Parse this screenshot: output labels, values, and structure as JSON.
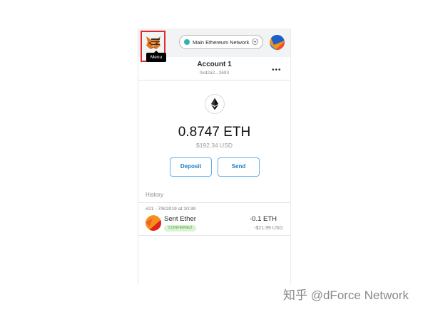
{
  "header": {
    "network_label": "Main Ethereum Network"
  },
  "account": {
    "name": "Account 1",
    "address": "0xd2a2...2693",
    "menu_tooltip": "Menu",
    "more_label": "•••"
  },
  "balance": {
    "eth": "0.8747 ETH",
    "usd": "$192.34 USD"
  },
  "actions": {
    "deposit_label": "Deposit",
    "send_label": "Send"
  },
  "history": {
    "label": "History",
    "transactions": [
      {
        "meta": "#21 - 7/8/2019 at 20:39",
        "title": "Sent Ether",
        "status": "CONFIRMED",
        "amount": "-0.1 ETH",
        "usd": "-$21.99 USD"
      }
    ]
  },
  "watermark": "知乎 @dForce Network",
  "colors": {
    "network_dot": "#29b6af",
    "button_border": "#65b0ea",
    "button_text": "#1b80c9",
    "highlight_box": "#e5262b",
    "confirmed_bg": "#d9f3d3",
    "confirmed_text": "#58a14a"
  },
  "icons": [
    "metamask-fox-icon",
    "chevron-down-icon",
    "account-avatar",
    "hamburger-menu-icon",
    "more-options-icon",
    "ethereum-logo-icon",
    "transaction-avatar"
  ]
}
